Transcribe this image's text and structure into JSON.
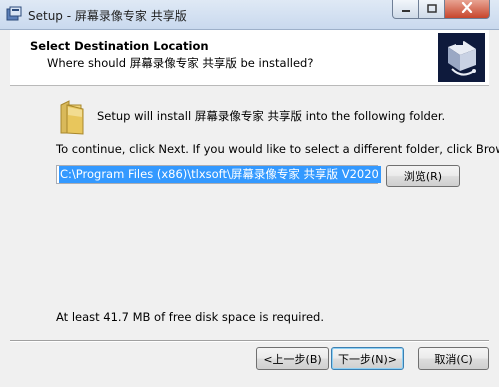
{
  "window": {
    "title": "Setup - 屏幕录像专家 共享版",
    "controls": {
      "minimize": "minimize",
      "maximize": "maximize",
      "close": "close"
    }
  },
  "header": {
    "title": "Select Destination Location",
    "subtitle": "Where should 屏幕录像专家 共享版 be installed?"
  },
  "content": {
    "install_message": "Setup will install 屏幕录像专家 共享版 into the following folder.",
    "continue_message": "To continue, click Next. If you would like to select a different folder, click Browse.",
    "path_value": "C:\\Program Files (x86)\\tlxsoft\\屏幕录像专家 共享版 V2020",
    "browse_label": "浏览(R)",
    "disk_space_message": "At least 41.7 MB of free disk space is required."
  },
  "footer": {
    "back_label": "<上一步(B)",
    "next_label": "下一步(N)>",
    "cancel_label": "取消(C)"
  },
  "colors": {
    "title_bar": "#c9d9ee",
    "close_button": "#c7452c",
    "selection": "#3399ff",
    "header_bg": "#ffffff",
    "dialog_bg": "#f0f0f0"
  }
}
